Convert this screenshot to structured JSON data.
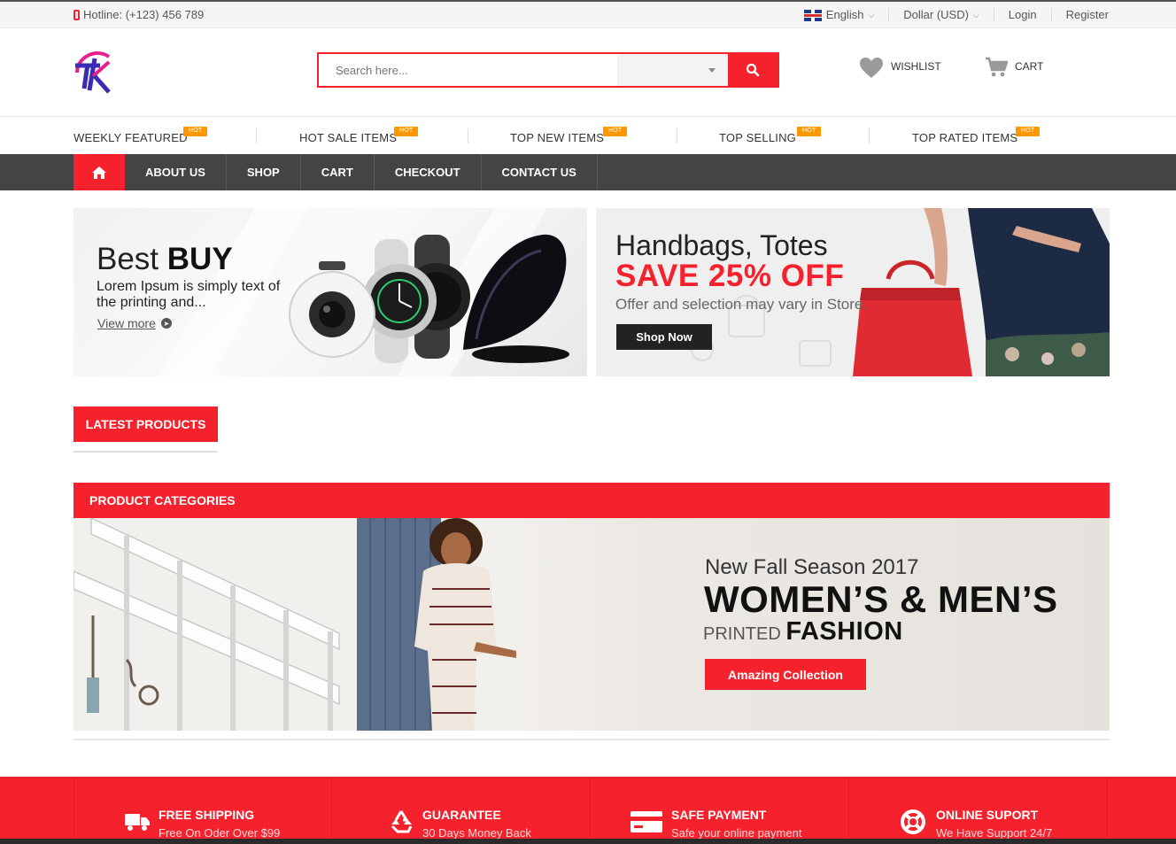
{
  "topbar": {
    "hotline": "Hotline: (+123) 456 789",
    "language": "English",
    "currency": "Dollar (USD)",
    "login": "Login",
    "register": "Register"
  },
  "header": {
    "search_placeholder": "Search here...",
    "search_category": "",
    "wishlist": "WISHLIST",
    "cart": "CART"
  },
  "tabs": [
    {
      "label": "WEEKLY FEATURED",
      "badge": "HOT"
    },
    {
      "label": "HOT SALE ITEMS",
      "badge": "HOT"
    },
    {
      "label": "TOP NEW ITEMS",
      "badge": "HOT"
    },
    {
      "label": "TOP SELLING",
      "badge": "HOT"
    },
    {
      "label": "TOP RATED ITEMS",
      "badge": "HOT"
    }
  ],
  "nav": [
    "ABOUT US",
    "SHOP",
    "CART",
    "CHECKOUT",
    "CONTACT US"
  ],
  "banner1": {
    "title_light": "Best ",
    "title_bold": "BUY",
    "text": "Lorem Ipsum is simply text of the printing and...",
    "link": "View more"
  },
  "banner2": {
    "title": "Handbags, Totes",
    "save": "SAVE 25% OFF",
    "text": "Offer and selection may vary in Store.",
    "button": "Shop Now"
  },
  "latest": "LATEST PRODUCTS",
  "categories": {
    "heading": "PRODUCT CATEGORIES",
    "season": "New Fall Season 2017",
    "big": "WOMEN’S & MEN’S",
    "printed": "PRINTED ",
    "fashion": "FASHION",
    "button": "Amazing Collection"
  },
  "services": [
    {
      "title": "FREE SHIPPING",
      "sub": "Free On Oder Over $99"
    },
    {
      "title": "GUARANTEE",
      "sub": "30 Days Money Back"
    },
    {
      "title": "SAFE PAYMENT",
      "sub": "Safe your online payment"
    },
    {
      "title": "ONLINE SUPORT",
      "sub": "We Have Support 24/7"
    }
  ],
  "colors": {
    "accent": "#f5222d",
    "nav": "#444444",
    "hot": "#ff9800"
  }
}
